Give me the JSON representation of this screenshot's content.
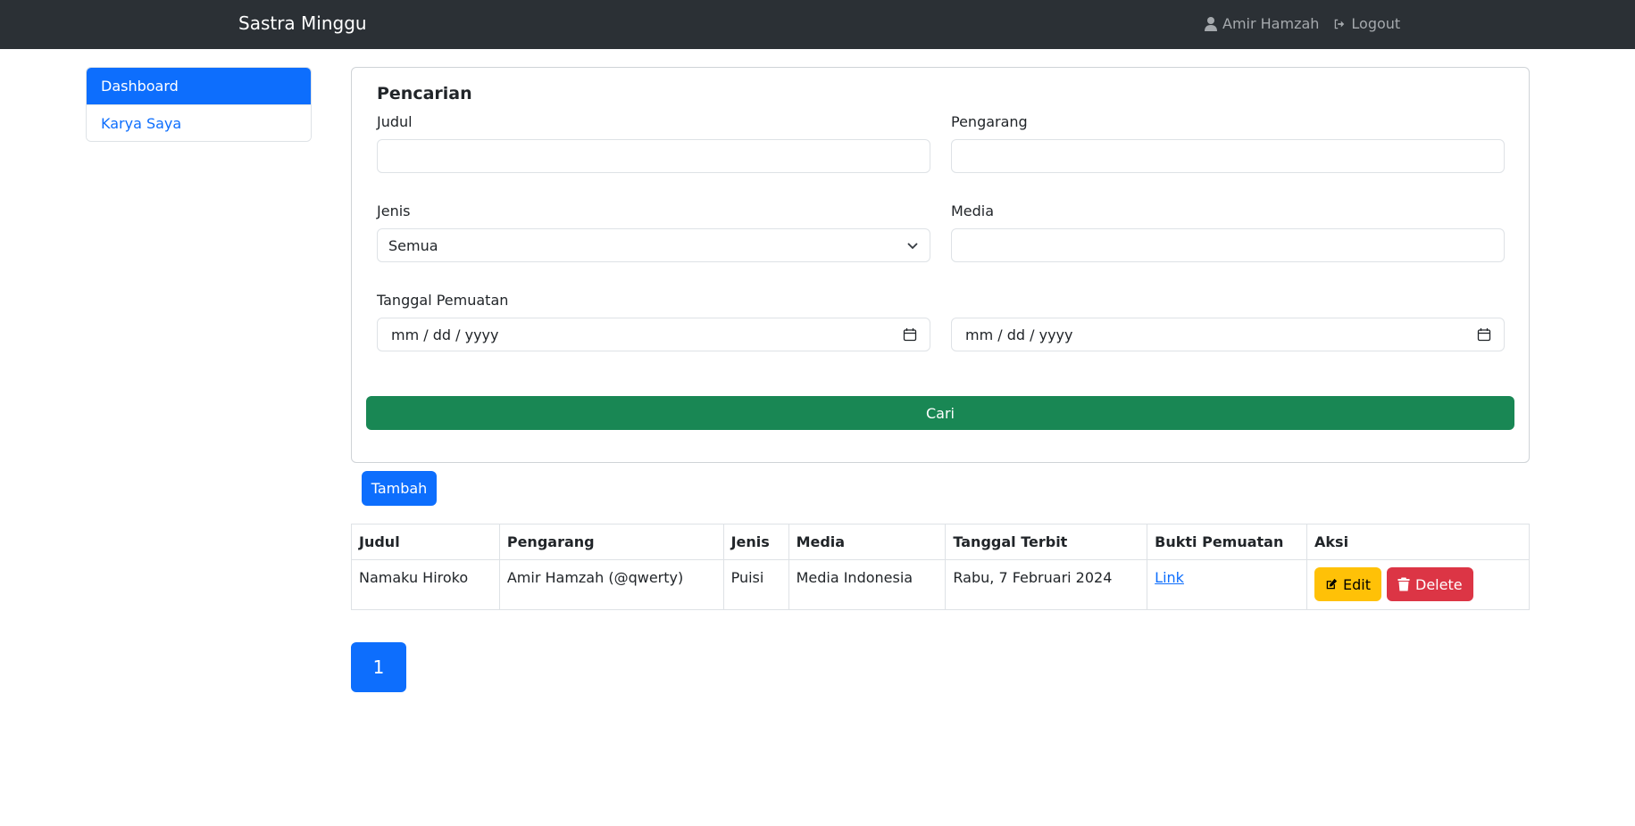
{
  "navbar": {
    "brand": "Sastra Minggu",
    "user_name": "Amir Hamzah",
    "logout_label": "Logout"
  },
  "sidebar": {
    "items": [
      {
        "label": "Dashboard",
        "active": true
      },
      {
        "label": "Karya Saya",
        "active": false
      }
    ]
  },
  "search": {
    "title": "Pencarian",
    "judul_label": "Judul",
    "judul_value": "",
    "pengarang_label": "Pengarang",
    "pengarang_value": "",
    "jenis_label": "Jenis",
    "jenis_selected": "Semua",
    "media_label": "Media",
    "media_value": "",
    "tanggal_label": "Tanggal Pemuatan",
    "date_from_placeholder": "mm / dd / yyyy",
    "date_to_placeholder": "mm / dd / yyyy",
    "submit_label": "Cari"
  },
  "add_button_label": "Tambah",
  "table": {
    "headers": [
      "Judul",
      "Pengarang",
      "Jenis",
      "Media",
      "Tanggal Terbit",
      "Bukti Pemuatan",
      "Aksi"
    ],
    "rows": [
      {
        "judul": "Namaku Hiroko",
        "pengarang": "Amir Hamzah (@qwerty)",
        "jenis": "Puisi",
        "media": "Media Indonesia",
        "tanggal": "Rabu, 7 Februari 2024",
        "bukti": "Link",
        "edit_label": "Edit",
        "delete_label": "Delete"
      }
    ]
  },
  "pagination": {
    "current_page": "1"
  },
  "colors": {
    "navbar": "#2b3035",
    "primary": "#0d6efd",
    "success": "#198754",
    "warning": "#ffc107",
    "danger": "#dc3545"
  },
  "icons": {
    "user": "user-icon",
    "logout": "logout-icon",
    "select_caret": "chevron-down-icon",
    "calendar": "calendar-icon",
    "edit": "edit-icon",
    "delete": "trash-icon"
  }
}
